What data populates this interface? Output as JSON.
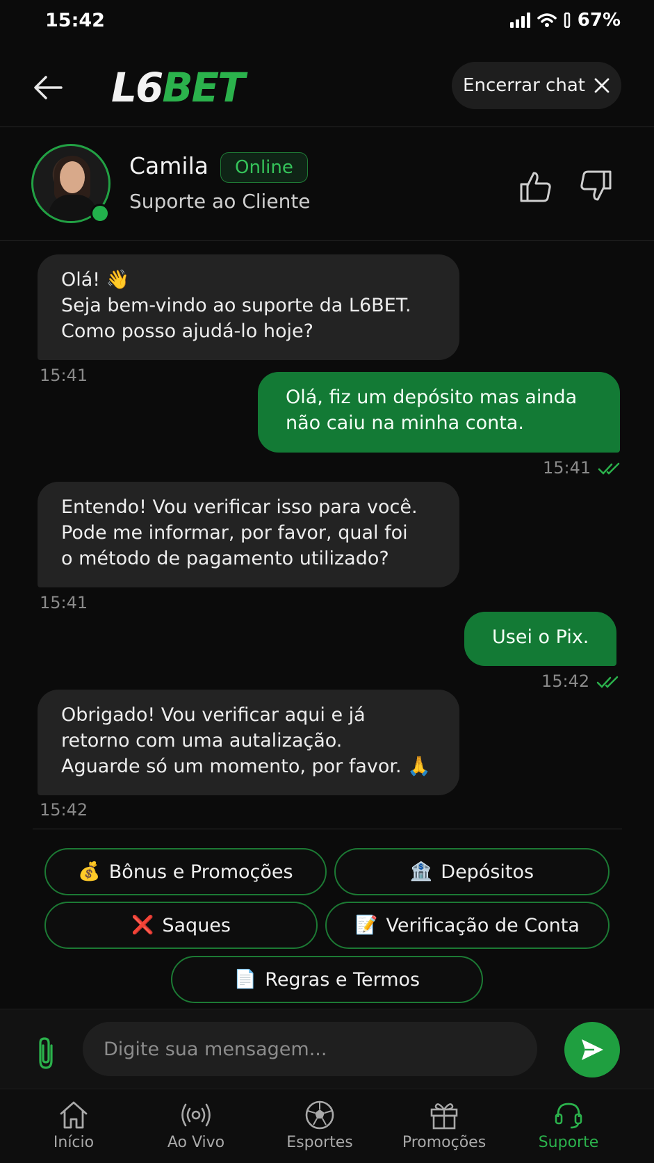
{
  "status_bar": {
    "time": "15:42",
    "battery": "67%"
  },
  "header": {
    "logo_part1": "L6",
    "logo_part2": "BET",
    "end_chat_label": "Encerrar chat"
  },
  "agent": {
    "name": "Camila",
    "status": "Online",
    "role": "Suporte ao Cliente"
  },
  "messages": [
    {
      "from": "agent",
      "lines": [
        "Olá! 👋",
        "Seja bem-vindo ao suporte da L6BET.",
        "Como posso ajudá-lo hoje?"
      ],
      "time": "15:41"
    },
    {
      "from": "user",
      "lines": [
        "Olá, fiz um depósito mas ainda",
        "não caiu na minha conta."
      ],
      "time": "15:41"
    },
    {
      "from": "agent",
      "lines": [
        "Entendo! Vou verificar isso para você.",
        "Pode me informar, por favor, qual foi",
        "o método de pagamento utilizado?"
      ],
      "time": "15:41"
    },
    {
      "from": "user",
      "lines": [
        "Usei o Pix."
      ],
      "time": "15:42"
    },
    {
      "from": "agent",
      "lines": [
        "Obrigado! Vou verificar aqui e já",
        "retorno com uma autalização.",
        "Aguarde só um momento, por favor. 🙏"
      ],
      "time": "15:42"
    }
  ],
  "quick_replies": [
    {
      "emoji": "💰",
      "label": "Bônus e Promoções"
    },
    {
      "emoji": "🏦",
      "label": "Depósitos"
    },
    {
      "emoji": "❌",
      "label": "Saques"
    },
    {
      "emoji": "📝",
      "label": "Verificação de Conta"
    },
    {
      "emoji": "📄",
      "label": "Regras e Termos"
    }
  ],
  "composer": {
    "placeholder": "Digite sua mensagem..."
  },
  "bottom_nav": [
    {
      "label": "Início",
      "icon": "home-icon"
    },
    {
      "label": "Ao Vivo",
      "icon": "live-icon"
    },
    {
      "label": "Esportes",
      "icon": "soccer-ball-icon"
    },
    {
      "label": "Promoções",
      "icon": "gift-icon"
    },
    {
      "label": "Suporte",
      "icon": "headset-icon",
      "active": true
    }
  ],
  "colors": {
    "accent": "#2bb24c",
    "user_bubble": "#137a35",
    "agent_bubble": "#232323",
    "background": "#0b0b0b"
  }
}
